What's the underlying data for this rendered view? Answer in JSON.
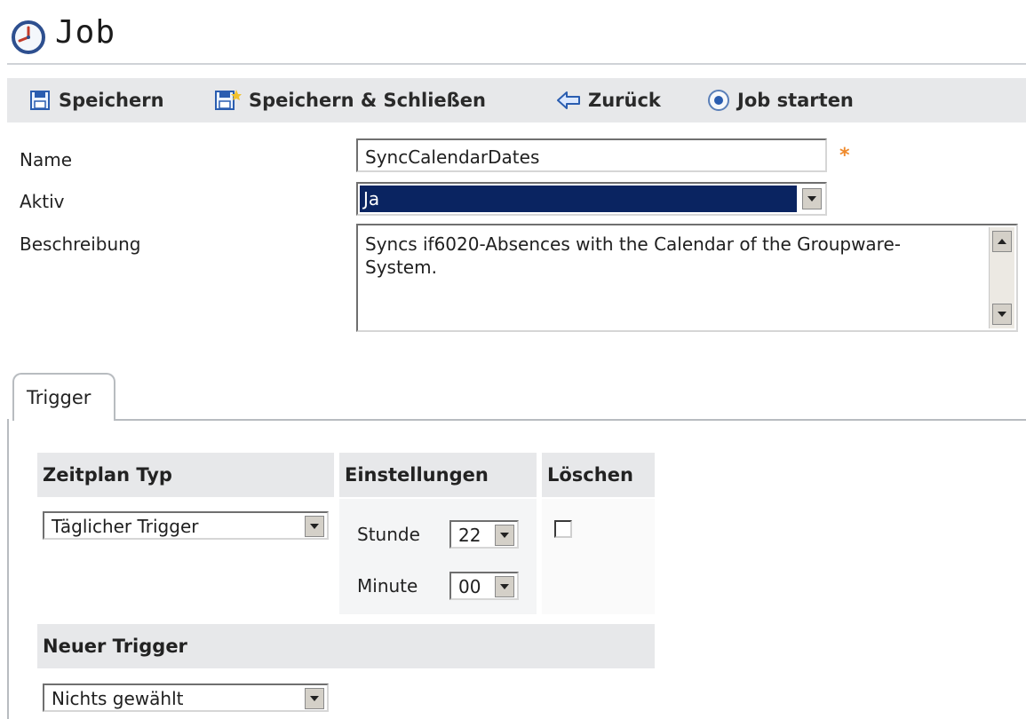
{
  "header": {
    "title": "Job"
  },
  "toolbar": {
    "save_label": "Speichern",
    "save_close_label": "Speichern & Schließen",
    "back_label": "Zurück",
    "start_label": "Job starten"
  },
  "form": {
    "name_label": "Name",
    "name_value": "SyncCalendarDates",
    "required_mark": "*",
    "active_label": "Aktiv",
    "active_value": "Ja",
    "description_label": "Beschreibung",
    "description_value": "Syncs if6020-Absences with the Calendar of the Groupware-System."
  },
  "tabs": [
    {
      "label": "Trigger",
      "selected": true
    }
  ],
  "trigger_table": {
    "headers": {
      "type": "Zeitplan Typ",
      "settings": "Einstellungen",
      "delete": "Löschen"
    },
    "row": {
      "type_value": "Täglicher Trigger",
      "hour_label": "Stunde",
      "hour_value": "22",
      "minute_label": "Minute",
      "minute_value": "00",
      "delete_checked": false
    },
    "new_trigger_header": "Neuer Trigger",
    "new_trigger_value": "Nichts gewählt"
  },
  "colors": {
    "selection": "#0a2461",
    "required": "#ef8a2c",
    "toolbar_bg": "#e7e8ea"
  },
  "icons": [
    "clock-icon",
    "save-icon",
    "save-close-icon",
    "back-arrow-icon",
    "start-job-icon",
    "chevron-down-icon"
  ]
}
